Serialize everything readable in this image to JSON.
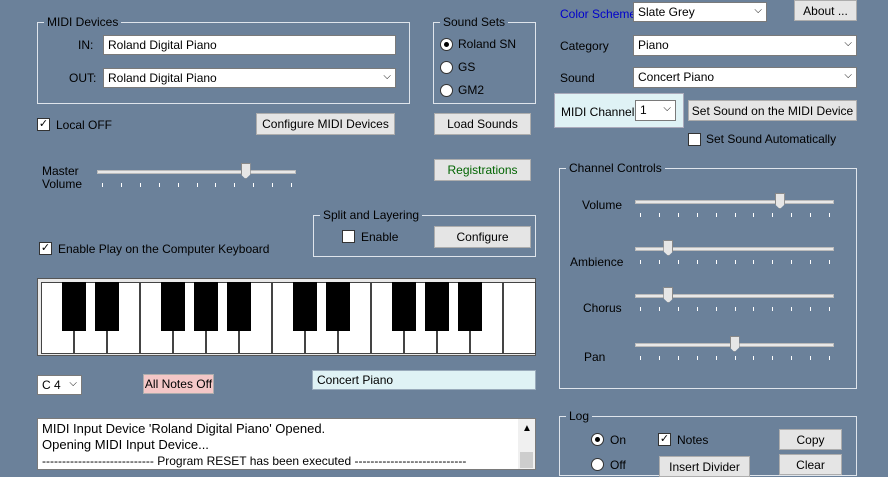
{
  "midi_devices": {
    "legend": "MIDI Devices",
    "in_label": "IN:",
    "in_value": "Roland Digital Piano",
    "out_label": "OUT:",
    "out_value": "Roland Digital Piano"
  },
  "sound_sets": {
    "legend": "Sound Sets",
    "options": [
      "Roland SN",
      "GS",
      "GM2"
    ],
    "selected": "Roland SN"
  },
  "color_scheme": {
    "label": "Color Scheme",
    "value": "Slate Grey"
  },
  "about_button": "About ...",
  "category": {
    "label": "Category",
    "value": "Piano"
  },
  "sound": {
    "label": "Sound",
    "value": "Concert Piano"
  },
  "midi_channel": {
    "label": "MIDI Channel",
    "value": "1"
  },
  "set_sound_button": "Set Sound on the MIDI Device",
  "set_sound_auto": {
    "label": "Set Sound Automatically",
    "checked": false
  },
  "local_off": {
    "label": "Local OFF",
    "checked": true
  },
  "configure_midi_button": "Configure MIDI Devices",
  "load_sounds_button": "Load Sounds",
  "master_volume": {
    "label_line1": "Master",
    "label_line2": "Volume",
    "level": 0.76
  },
  "registrations_button": "Registrations",
  "split_layering": {
    "legend": "Split and Layering",
    "enable_label": "Enable",
    "enabled": false,
    "configure_button": "Configure"
  },
  "enable_play_keyboard": {
    "label": "Enable Play on the Computer Keyboard",
    "checked": true
  },
  "octave": {
    "value": "C 4"
  },
  "all_notes_off_button": "All Notes Off",
  "current_sound_display": "Concert Piano",
  "channel_controls": {
    "legend": "Channel Controls",
    "volume": {
      "label": "Volume",
      "level": 0.74
    },
    "ambience": {
      "label": "Ambience",
      "level": 0.15
    },
    "chorus": {
      "label": "Chorus",
      "level": 0.15
    },
    "pan": {
      "label": "Pan",
      "level": 0.5
    }
  },
  "log_panel": {
    "legend": "Log",
    "on_label": "On",
    "off_label": "Off",
    "notes_label": "Notes",
    "notes_checked": true,
    "copy_button": "Copy",
    "insert_divider_button": "Insert Divider",
    "clear_button": "Clear"
  },
  "log_lines": [
    "MIDI Input Device 'Roland Digital Piano' Opened.",
    "Opening MIDI Input Device...",
    "---------------------------- Program RESET has been executed ----------------------------"
  ],
  "colors": {
    "background": "#6b819a",
    "link_blue": "#0000cc",
    "registrations_text": "#006400",
    "all_notes_off_bg": "#f4c7c7",
    "display_bg": "#dff2f5"
  }
}
